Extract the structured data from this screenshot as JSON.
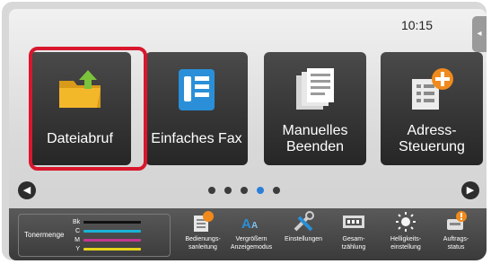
{
  "status_bar": {
    "time": "10:15"
  },
  "tiles": [
    {
      "label": "Dateiabruf",
      "icon": "folder-icon"
    },
    {
      "label": "Einfaches Fax",
      "icon": "fax-icon"
    },
    {
      "label": "Manuelles Beenden",
      "icon": "documents-icon"
    },
    {
      "label": "Adress-Steuerung",
      "icon": "address-add-icon"
    }
  ],
  "pagination": {
    "pages": 5,
    "active_page": 4
  },
  "toner": {
    "label": "Tonermenge",
    "colors": [
      {
        "name": "Bk",
        "color": "#111111"
      },
      {
        "name": "C",
        "color": "#19b3d6"
      },
      {
        "name": "M",
        "color": "#c3388f"
      },
      {
        "name": "Y",
        "color": "#e6d21c"
      }
    ]
  },
  "shortcuts": [
    {
      "label": "Bedienungs-\nsanleitung",
      "icon": "manual-icon"
    },
    {
      "label": "Vergrößern\nAnzeigemodus",
      "icon": "zoom-display-icon"
    },
    {
      "label": "Einstellungen",
      "icon": "settings-tools-icon"
    },
    {
      "label": "Gesam-\ntzählung",
      "icon": "counter-icon"
    },
    {
      "label": "Helligkeits-\neinstellung",
      "icon": "brightness-icon"
    },
    {
      "label": "Auftrags-\nstatus",
      "icon": "job-status-icon"
    }
  ]
}
